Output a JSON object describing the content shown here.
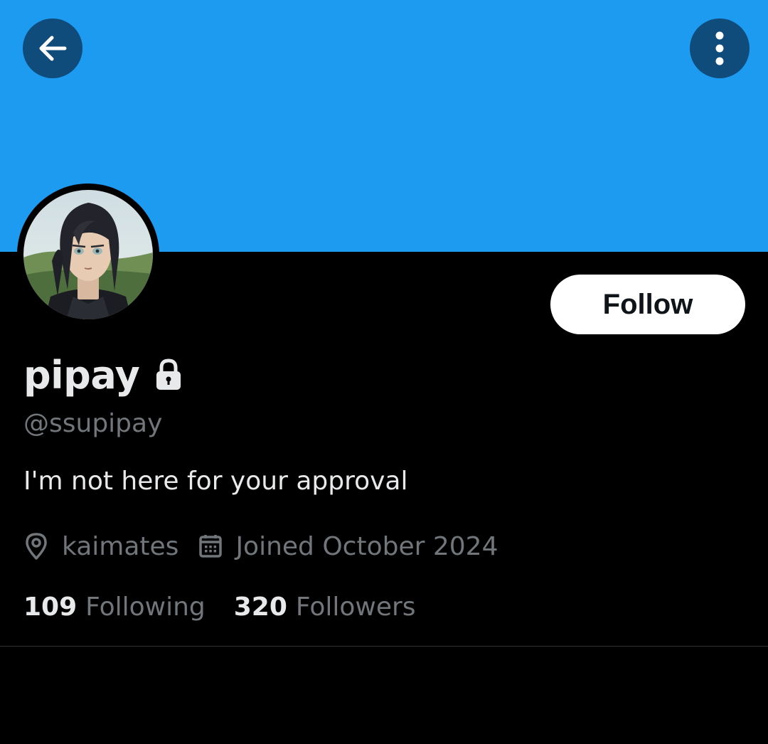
{
  "profile": {
    "display_name": "pipay",
    "handle": "@ssupipay",
    "bio": "I'm not here for your approval",
    "location": "kaimates",
    "joined": "Joined October 2024",
    "following_count": "109",
    "following_label": "Following",
    "followers_count": "320",
    "followers_label": "Followers"
  },
  "header": {
    "back_icon": "arrow-left-icon",
    "more_icon": "more-vertical-icon"
  },
  "actions": {
    "follow_label": "Follow"
  },
  "icons": {
    "protected": "lock-icon",
    "location": "location-pin-icon",
    "joined": "calendar-icon"
  },
  "colors": {
    "banner": "#1d9bf0",
    "background": "#000000",
    "primary_text": "#e7e9ea",
    "secondary_text": "#71767b",
    "header_button": "#0f4c7c",
    "follow_button_bg": "#ffffff",
    "follow_button_text": "#0f1419"
  }
}
